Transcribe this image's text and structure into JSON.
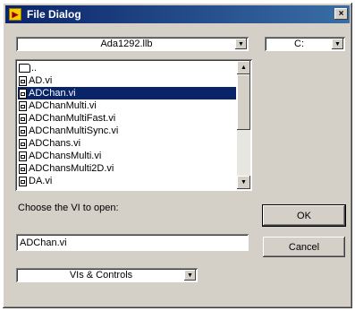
{
  "window": {
    "title": "File Dialog",
    "close_label": "×"
  },
  "location": {
    "library": "Ada1292.llb",
    "drive": "C:"
  },
  "file_list": {
    "items": [
      {
        "label": "..",
        "kind": "folder"
      },
      {
        "label": "AD.vi",
        "kind": "file"
      },
      {
        "label": "ADChan.vi",
        "kind": "file",
        "selected": true
      },
      {
        "label": "ADChanMulti.vi",
        "kind": "file"
      },
      {
        "label": "ADChanMultiFast.vi",
        "kind": "file"
      },
      {
        "label": "ADChanMultiSync.vi",
        "kind": "file"
      },
      {
        "label": "ADChans.vi",
        "kind": "file"
      },
      {
        "label": "ADChansMulti.vi",
        "kind": "file"
      },
      {
        "label": "ADChansMulti2D.vi",
        "kind": "file"
      },
      {
        "label": "DA.vi",
        "kind": "file"
      }
    ]
  },
  "prompt": {
    "label": "Choose the VI to open:"
  },
  "filename": {
    "value": "ADChan.vi"
  },
  "buttons": {
    "ok": "OK",
    "cancel": "Cancel"
  },
  "filter": {
    "selected": "VIs & Controls"
  },
  "icons": {
    "dropdown": "▼",
    "scroll_up": "▲",
    "scroll_down": "▼"
  },
  "colors": {
    "titlebar": "#0a246a",
    "selection": "#0a246a",
    "face": "#d4d0c8"
  }
}
